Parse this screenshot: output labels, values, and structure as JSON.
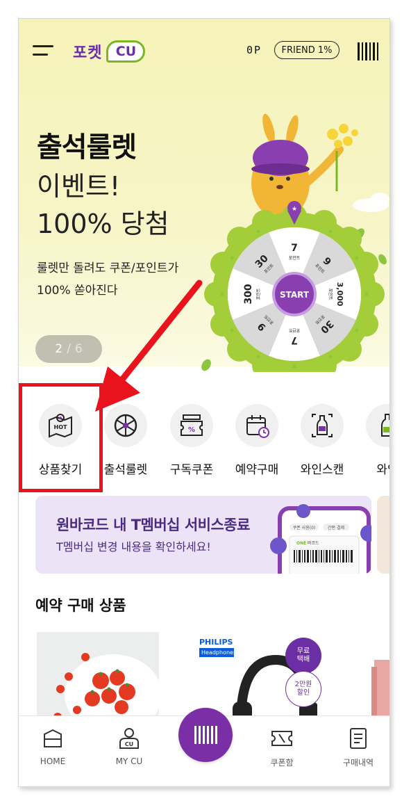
{
  "header": {
    "app_name": "포켓",
    "logo_badge": "CU",
    "points": "0P",
    "friend_badge": "FRIEND 1%"
  },
  "hero": {
    "title": "출석룰렛",
    "subtitle_1": "이벤트!",
    "subtitle_2": "100% 당첨",
    "desc_1": "룰렛만 돌려도 쿠폰/포인트가",
    "desc_2": "100% 쏟아진다",
    "page_current": "2",
    "page_sep": "/",
    "page_total": "6",
    "roulette": {
      "center_label": "START",
      "segments": [
        {
          "value": "7",
          "unit": "포인트"
        },
        {
          "value": "9",
          "unit": "포인트"
        },
        {
          "value": "3,000",
          "unit": "포인트"
        },
        {
          "value": "30",
          "unit": "포인트"
        },
        {
          "value": "7",
          "unit": "포인트"
        },
        {
          "value": "9",
          "unit": "포인트"
        },
        {
          "value": "300",
          "unit": "포인트"
        },
        {
          "value": "30",
          "unit": "포인트"
        }
      ]
    }
  },
  "quick_menu": [
    {
      "label": "상품찾기",
      "icon": "map-hot-icon"
    },
    {
      "label": "출석룰렛",
      "icon": "roulette-icon"
    },
    {
      "label": "구독쿠폰",
      "icon": "coupon-icon"
    },
    {
      "label": "예약구매",
      "icon": "calendar-clock-icon"
    },
    {
      "label": "와인스캔",
      "icon": "wine-scan-icon"
    },
    {
      "label": "와인",
      "icon": "wine-bottle-icon"
    }
  ],
  "banner": {
    "title": "원바코드 내 T멤버십 서비스종료",
    "subtitle": "T멤버십 변경 내용을 확인하세요!",
    "phone_chip_1": "쿠폰 사용(0)",
    "phone_chip_2": "간편 결제",
    "phone_one": "ONE",
    "phone_barcode": "바코드"
  },
  "section": {
    "title": "예약 구매 상품"
  },
  "products": {
    "brand": "PHILIPS",
    "brand_sub": "Headphones",
    "badge_1": "무료\n택배",
    "badge_1a": "무료",
    "badge_1b": "택배",
    "badge_2a": "2만원",
    "badge_2b": "할인"
  },
  "bottom_nav": {
    "home": "HOME",
    "my_cu": "MY CU",
    "coupon_box": "쿠폰함",
    "purchase_history": "구매내역"
  },
  "colors": {
    "brand_purple": "#6b2fa3",
    "brand_green": "#7ab723",
    "hero_bg": "#f6f3b9",
    "highlight_red": "#e8131c",
    "nav_center": "#7b2fa6"
  }
}
